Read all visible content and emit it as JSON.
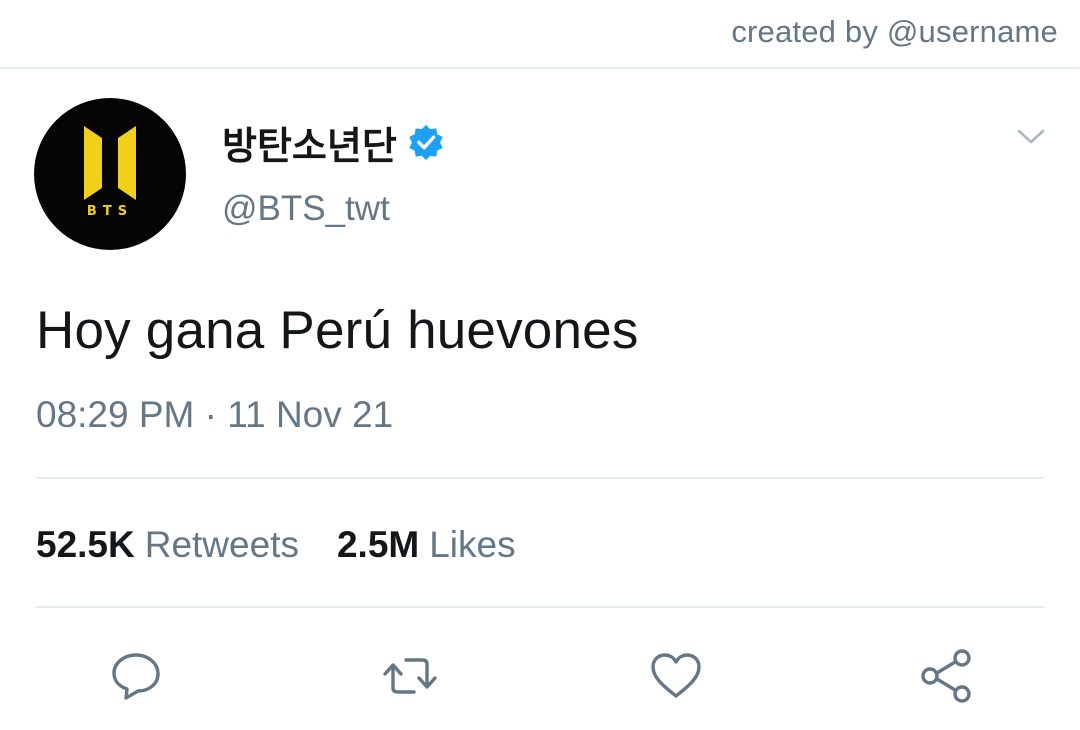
{
  "header": {
    "credit": "created by @username"
  },
  "tweet": {
    "avatar_text": "BTS",
    "display_name": "방탄소년단",
    "verified": true,
    "handle": "@BTS_twt",
    "text": "Hoy gana Perú huevones",
    "timestamp": "08:29 PM · 11 Nov 21"
  },
  "stats": {
    "retweets_value": "52.5K",
    "retweets_label": "Retweets",
    "likes_value": "2.5M",
    "likes_label": "Likes"
  },
  "actions": [
    {
      "name": "reply",
      "icon": "reply-icon"
    },
    {
      "name": "retweet",
      "icon": "retweet-icon"
    },
    {
      "name": "like",
      "icon": "heart-icon"
    },
    {
      "name": "share",
      "icon": "share-icon"
    }
  ],
  "colors": {
    "text_primary": "#14171a",
    "text_secondary": "#657786",
    "divider": "#e6ecf0",
    "verified_blue": "#1da1f2",
    "avatar_background": "#050505",
    "logo_yellow": "#f2cf1a"
  }
}
